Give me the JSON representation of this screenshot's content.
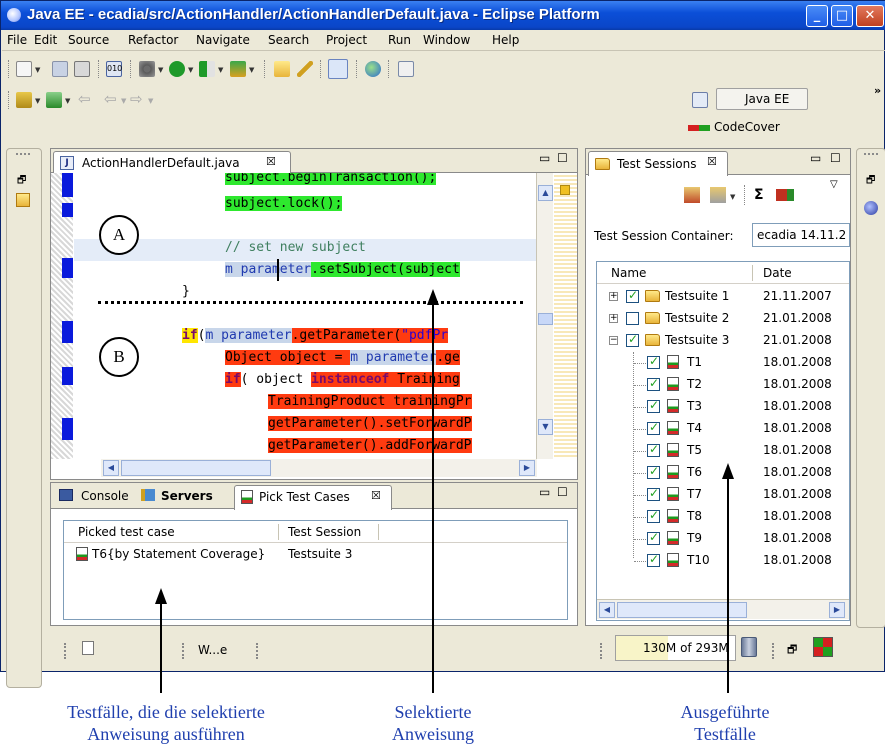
{
  "window": {
    "title": "Java EE - ecadia/src/ActionHandler/ActionHandlerDefault.java - Eclipse Platform"
  },
  "menu": [
    "File",
    "Edit",
    "Source",
    "Refactor",
    "Navigate",
    "Search",
    "Project",
    "Run",
    "Window",
    "Help"
  ],
  "toolbar": {
    "perspective": "Java EE",
    "codecover": "CodeCover"
  },
  "editor": {
    "tab": "ActionHandlerDefault.java",
    "lines": {
      "l1": "subject.beginTransaction();",
      "l2": "subject.lock();",
      "l3": "// set new subject",
      "l4a": "m parameter",
      "l4b": ".setSubject(subject",
      "l5": "}",
      "l6kw": "if",
      "l6a": "(",
      "l6b": "m parameter",
      "l6c": ".getParameter(",
      "l6d": "\"pdfPr",
      "l7a": "Object object = ",
      "l7b": "m parameter",
      "l7c": ".ge",
      "l8kw": "if",
      "l8a": "( object ",
      "l8b": "instanceof",
      "l8c": " Training",
      "l9": "TrainingProduct trainingPr",
      "l10": "getParameter().setForwardP",
      "l11": "getParameter().addForwardP"
    },
    "label_a": "A",
    "label_b": "B"
  },
  "bottom_panel": {
    "tabs": [
      "Console",
      "Servers",
      "Pick Test Cases"
    ],
    "columns": [
      "Picked test case",
      "Test Session"
    ],
    "rows": [
      {
        "case": "T6{by Statement Coverage}",
        "session": "Testsuite 3"
      }
    ]
  },
  "test_sessions": {
    "tab": "Test Sessions",
    "container_label": "Test Session Container:",
    "container_value": "ecadia 14.11.2",
    "columns": [
      "Name",
      "Date"
    ],
    "suites": [
      {
        "name": "Testsuite 1",
        "date": "21.11.2007",
        "checked": true,
        "expanded": false
      },
      {
        "name": "Testsuite 2",
        "date": "21.01.2008",
        "checked": false,
        "expanded": false
      },
      {
        "name": "Testsuite 3",
        "date": "21.01.2008",
        "checked": true,
        "expanded": true
      }
    ],
    "cases": [
      {
        "name": "T1",
        "date": "18.01.2008"
      },
      {
        "name": "T2",
        "date": "18.01.2008"
      },
      {
        "name": "T3",
        "date": "18.01.2008"
      },
      {
        "name": "T4",
        "date": "18.01.2008"
      },
      {
        "name": "T5",
        "date": "18.01.2008"
      },
      {
        "name": "T6",
        "date": "18.01.2008"
      },
      {
        "name": "T7",
        "date": "18.01.2008"
      },
      {
        "name": "T8",
        "date": "18.01.2008"
      },
      {
        "name": "T9",
        "date": "18.01.2008"
      },
      {
        "name": "T10",
        "date": "18.01.2008"
      }
    ]
  },
  "statusbar": {
    "item": "W...e",
    "memory": "130M of 293M"
  },
  "captions": {
    "left1": "Testfälle, die die selektierte",
    "left2": "Anweisung ausführen",
    "mid1": "Selektierte",
    "mid2": "Anweisung",
    "right1": "Ausgeführte",
    "right2": "Testfälle"
  }
}
